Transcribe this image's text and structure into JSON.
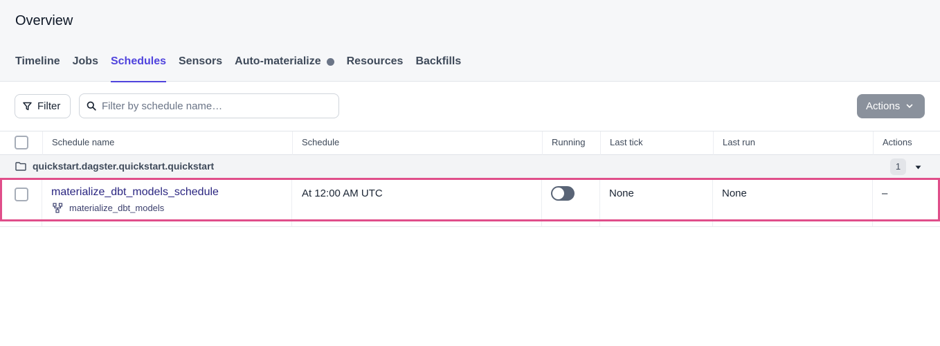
{
  "page": {
    "title": "Overview"
  },
  "tabs": [
    {
      "label": "Timeline",
      "active": false
    },
    {
      "label": "Jobs",
      "active": false
    },
    {
      "label": "Schedules",
      "active": true
    },
    {
      "label": "Sensors",
      "active": false
    },
    {
      "label": "Auto-materialize",
      "active": false,
      "dot": true
    },
    {
      "label": "Resources",
      "active": false
    },
    {
      "label": "Backfills",
      "active": false
    }
  ],
  "toolbar": {
    "filter_label": "Filter",
    "search_placeholder": "Filter by schedule name…",
    "search_value": "",
    "actions_label": "Actions"
  },
  "table": {
    "headers": {
      "name": "Schedule name",
      "schedule": "Schedule",
      "running": "Running",
      "last_tick": "Last tick",
      "last_run": "Last run",
      "actions": "Actions"
    },
    "group": {
      "name": "quickstart.dagster.quickstart.quickstart",
      "count": "1"
    },
    "rows": [
      {
        "schedule_name": "materialize_dbt_models_schedule",
        "job_name": "materialize_dbt_models",
        "schedule": "At 12:00 AM UTC",
        "running": false,
        "last_tick": "None",
        "last_run": "None",
        "actions": "–"
      }
    ]
  },
  "colors": {
    "accent": "#4f43dd",
    "highlight": "#e04e8a",
    "toggle_off": "#596476",
    "actions_button": "#8a919c"
  },
  "icons": {
    "filter": "filter-funnel-icon",
    "search": "search-icon",
    "actions_chevron": "chevron-down-icon",
    "folder": "folder-icon",
    "group_toggle": "caret-down-icon",
    "job": "job-graph-icon"
  }
}
